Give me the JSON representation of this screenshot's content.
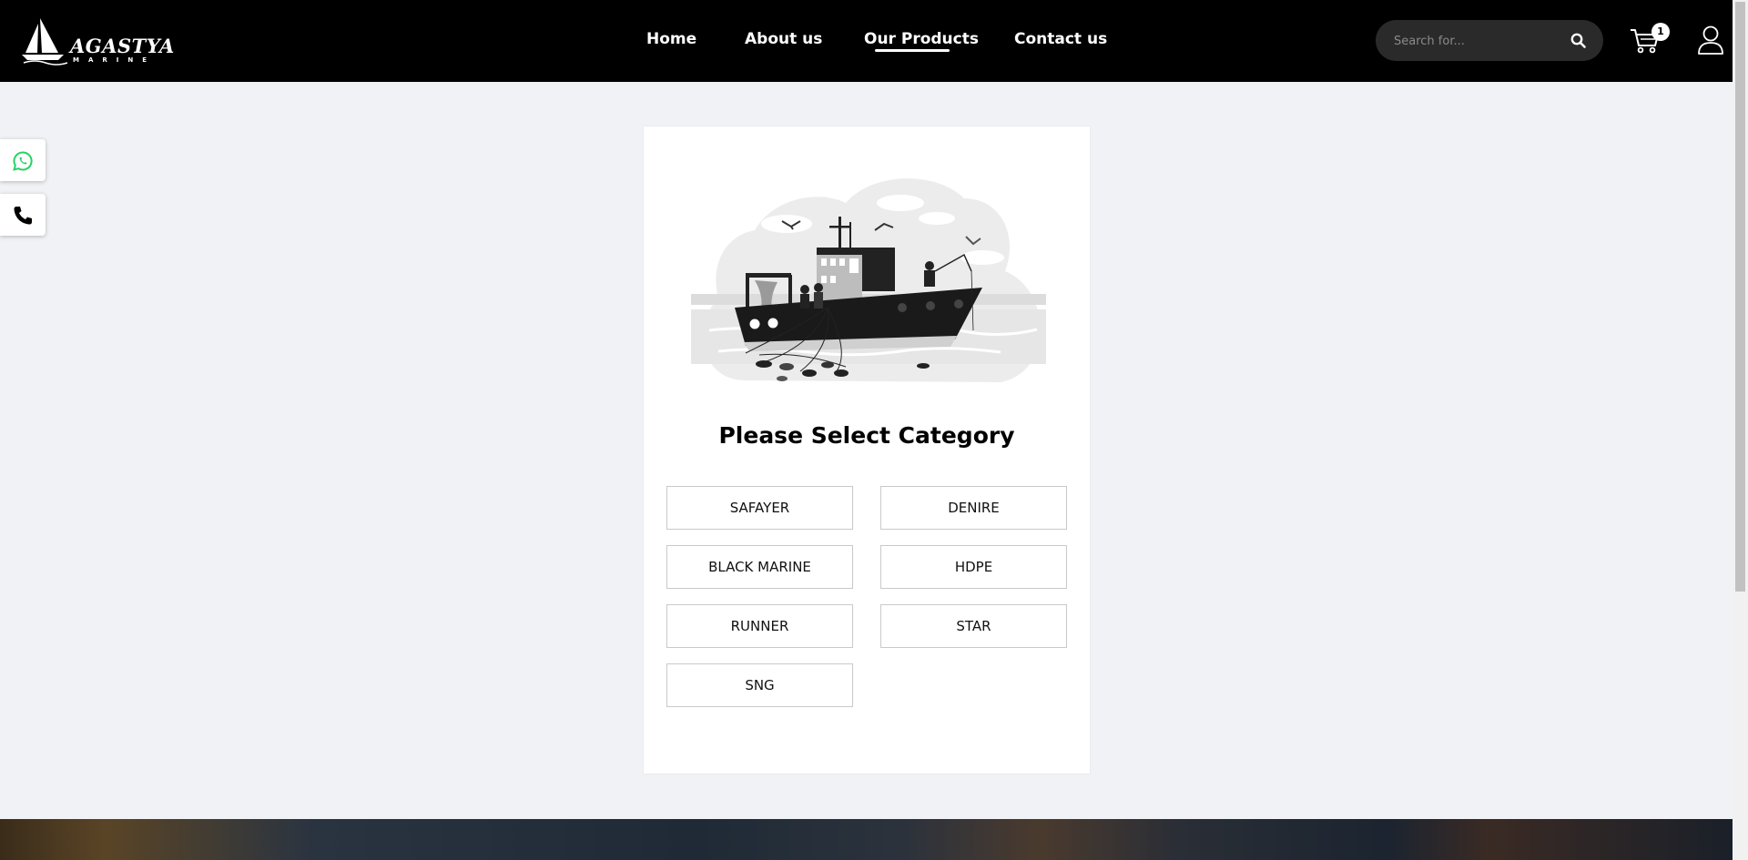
{
  "brand": {
    "name": "AGASTYA",
    "tagline": "MARINE"
  },
  "nav": {
    "items": [
      {
        "label": "Home",
        "active": false
      },
      {
        "label": "About us",
        "active": false
      },
      {
        "label": "Our Products",
        "active": true
      },
      {
        "label": "Contact us",
        "active": false
      }
    ]
  },
  "search": {
    "placeholder": "Search for..."
  },
  "cart": {
    "count": "1"
  },
  "floating": {
    "whatsapp_color": "#25d366"
  },
  "card": {
    "title": "Please Select Category",
    "categories": [
      "SAFAYER",
      "DENIRE",
      "BLACK MARINE",
      "HDPE",
      "RUNNER",
      "STAR",
      "SNG"
    ]
  }
}
